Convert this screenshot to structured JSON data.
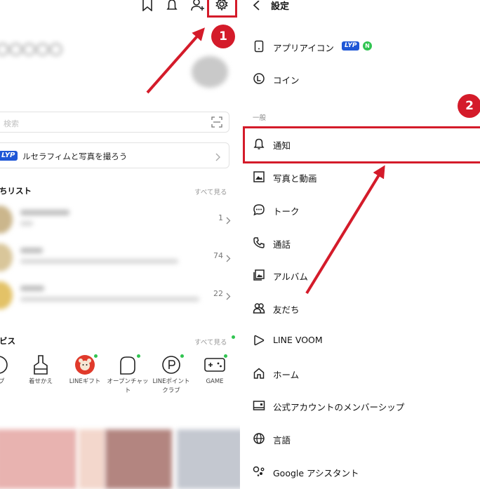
{
  "left": {
    "top_icons": [
      "bookmark-icon",
      "bell-icon",
      "add-friend-icon",
      "settings-gear-icon"
    ],
    "search": {
      "placeholder": "検索"
    },
    "promo": {
      "badge": "LYP",
      "text": "ルセラフィムと写真を撮ろう"
    },
    "friends_section": {
      "title": "ちリスト",
      "see_all": "すべて見る"
    },
    "friends": [
      {
        "count": "1"
      },
      {
        "count": "74"
      },
      {
        "count": "22"
      }
    ],
    "services_section": {
      "title": "ビス",
      "see_all": "すべて見る"
    },
    "services": [
      {
        "label": "ンプ",
        "icon": "stamp-icon"
      },
      {
        "label": "着せかえ",
        "icon": "brush-icon"
      },
      {
        "label": "LINEギフト",
        "icon": "gift-bear-icon"
      },
      {
        "label": "オープンチャット",
        "icon": "open-chat-icon"
      },
      {
        "label": "LINEポイントクラブ",
        "icon": "points-icon"
      },
      {
        "label": "GAME",
        "icon": "game-icon"
      }
    ]
  },
  "right": {
    "header": {
      "title": "設定"
    },
    "app_icon_item": {
      "label": "アプリアイコン",
      "badge": "LYP",
      "new_badge": "N"
    },
    "coin_item": {
      "label": "コイン"
    },
    "section_general": "一般",
    "items": [
      {
        "label": "通知",
        "icon": "bell-icon"
      },
      {
        "label": "写真と動画",
        "icon": "photo-icon"
      },
      {
        "label": "トーク",
        "icon": "chat-bubble-icon"
      },
      {
        "label": "通話",
        "icon": "phone-icon"
      },
      {
        "label": "アルバム",
        "icon": "album-icon"
      },
      {
        "label": "友だち",
        "icon": "friends-icon"
      },
      {
        "label": "LINE VOOM",
        "icon": "voom-play-icon"
      },
      {
        "label": "ホーム",
        "icon": "home-icon"
      },
      {
        "label": "公式アカウントのメンバーシップ",
        "icon": "membership-card-icon"
      },
      {
        "label": "言語",
        "icon": "globe-icon"
      },
      {
        "label": "Google アシスタント",
        "icon": "google-assistant-icon"
      }
    ]
  },
  "annotations": {
    "steps": [
      "1",
      "2"
    ],
    "color": "#d41b2a"
  }
}
